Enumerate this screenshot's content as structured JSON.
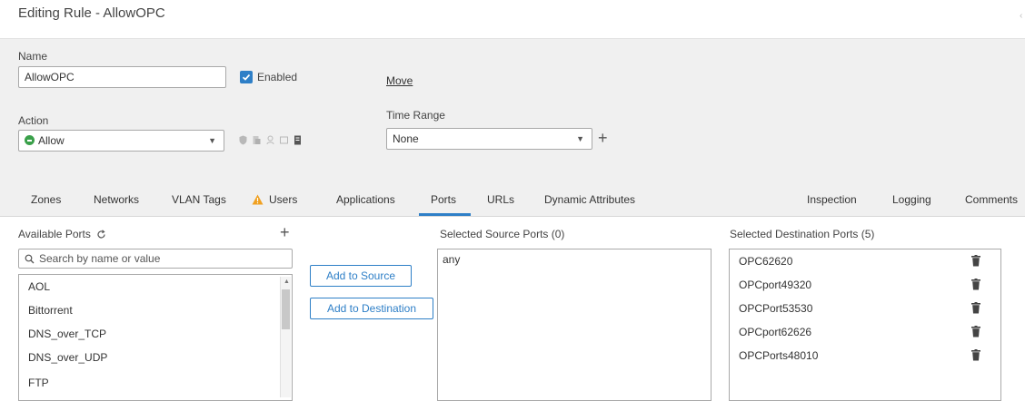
{
  "page": {
    "title": "Editing Rule - AllowOPC"
  },
  "form": {
    "name_label": "Name",
    "name_value": "AllowOPC",
    "enabled_label": "Enabled",
    "enabled_checked": true,
    "move_link": "Move",
    "action_label": "Action",
    "action_value": "Allow",
    "action_icon": "allow-circle-icon",
    "action_icon_color": "#3aa04a",
    "time_range_label": "Time Range",
    "time_range_value": "None"
  },
  "tabs": [
    {
      "label": "Zones"
    },
    {
      "label": "Networks"
    },
    {
      "label": "VLAN Tags"
    },
    {
      "label": "Users",
      "warning": true
    },
    {
      "label": "Applications"
    },
    {
      "label": "Ports",
      "active": true
    },
    {
      "label": "URLs"
    },
    {
      "label": "Dynamic Attributes"
    },
    {
      "label": "Inspection"
    },
    {
      "label": "Logging"
    },
    {
      "label": "Comments"
    }
  ],
  "available_ports": {
    "header": "Available Ports",
    "search_placeholder": "Search by name or value",
    "items": [
      "AOL",
      "Bittorrent",
      "DNS_over_TCP",
      "DNS_over_UDP",
      "FTP"
    ]
  },
  "buttons": {
    "add_to_source": "Add to Source",
    "add_to_destination": "Add to Destination"
  },
  "source_ports": {
    "header": "Selected Source Ports (0)",
    "items": [
      "any"
    ]
  },
  "destination_ports": {
    "header": "Selected Destination Ports (5)",
    "items": [
      "OPC62620",
      "OPCport49320",
      "OPCPort53530",
      "OPCport62626",
      "OPCPorts48010"
    ]
  },
  "colors": {
    "accent": "#2e7fc7",
    "warning": "#f0a020",
    "allow": "#3aa04a"
  }
}
